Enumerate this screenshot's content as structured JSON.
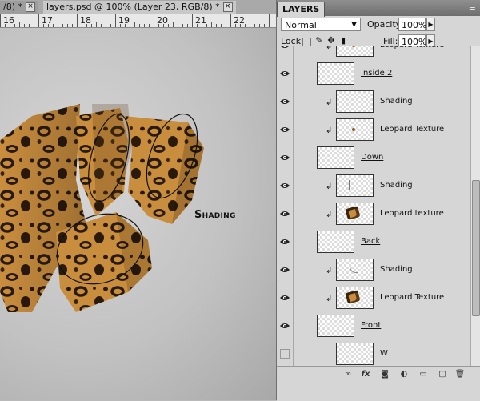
{
  "tabs": [
    {
      "label": "/8) *",
      "close": "×"
    },
    {
      "label": "layers.psd @ 100% (Layer 23, RGB/8) *",
      "close": "×"
    }
  ],
  "ruler": {
    "numbers": [
      "16",
      "17",
      "18",
      "19",
      "20",
      "21",
      "22"
    ]
  },
  "canvas": {
    "label": "Shading"
  },
  "panel": {
    "title": "LAYERS",
    "menu_icon": "≡",
    "blend_mode": "Normal",
    "opacity_label": "Opacity:",
    "opacity_value": "100%",
    "lock_label": "Lock:",
    "fill_label": "Fill:",
    "fill_value": "100%"
  },
  "layers": [
    {
      "name": "Leopard Texture",
      "visible": true,
      "clipped": true,
      "group": false,
      "thumb": "dot"
    },
    {
      "name": "Inside 2",
      "visible": true,
      "clipped": false,
      "group": true,
      "thumb": "none"
    },
    {
      "name": "Shading",
      "visible": true,
      "clipped": true,
      "group": false,
      "thumb": "none"
    },
    {
      "name": "Leopard Texture",
      "visible": true,
      "clipped": true,
      "group": false,
      "thumb": "dot"
    },
    {
      "name": "Down",
      "visible": true,
      "clipped": false,
      "group": true,
      "thumb": "none"
    },
    {
      "name": "Shading",
      "visible": true,
      "clipped": true,
      "group": false,
      "thumb": "stroke"
    },
    {
      "name": "Leopard texture",
      "visible": true,
      "clipped": true,
      "group": false,
      "thumb": "texture"
    },
    {
      "name": "Back",
      "visible": true,
      "clipped": false,
      "group": true,
      "thumb": "none"
    },
    {
      "name": "Shading",
      "visible": true,
      "clipped": true,
      "group": false,
      "thumb": "arc"
    },
    {
      "name": "Leopard Texture",
      "visible": true,
      "clipped": true,
      "group": false,
      "thumb": "texture"
    },
    {
      "name": "Front",
      "visible": true,
      "clipped": false,
      "group": true,
      "thumb": "none"
    },
    {
      "name": "W",
      "visible": false,
      "clipped": false,
      "group": false,
      "thumb": "none"
    }
  ],
  "colors": {
    "leopard_base": "#c98d3e",
    "leopard_spot": "#2a1a0c",
    "selection_outline": "#111111"
  },
  "footer_icons": [
    "link-icon",
    "fx-icon",
    "mask-icon",
    "adjustment-icon",
    "folder-icon",
    "new-layer-icon",
    "trash-icon"
  ]
}
